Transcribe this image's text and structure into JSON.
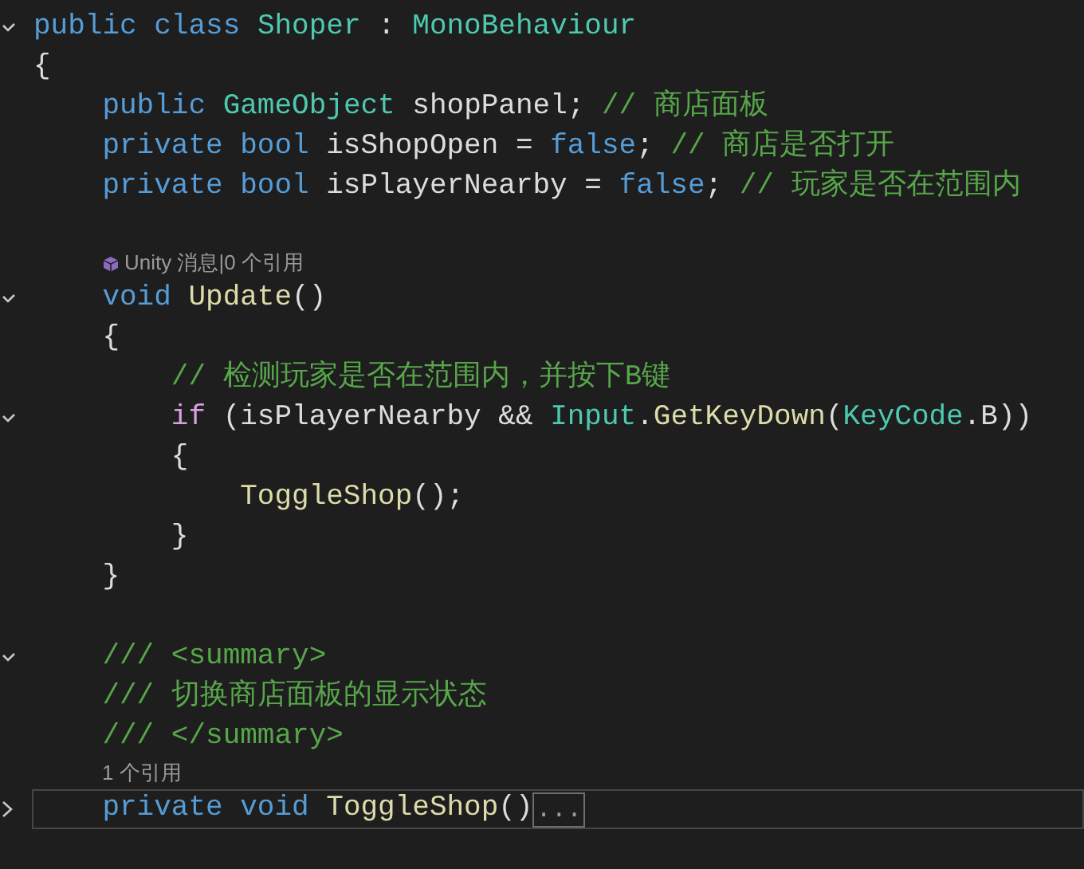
{
  "lines": [
    {
      "kind": "code",
      "expanded": true,
      "current": false,
      "tokens": [
        {
          "kind": "kw",
          "text": "public class "
        },
        {
          "kind": "type",
          "text": "Shoper"
        },
        {
          "kind": "plain",
          "text": " : "
        },
        {
          "kind": "type",
          "text": "MonoBehaviour"
        }
      ]
    },
    {
      "kind": "code",
      "current": false,
      "tokens": [
        {
          "kind": "plain",
          "text": "{"
        }
      ]
    },
    {
      "kind": "code",
      "current": false,
      "tokens": [
        {
          "kind": "kw",
          "text": "    public "
        },
        {
          "kind": "type",
          "text": "GameObject"
        },
        {
          "kind": "plain",
          "text": " shopPanel; "
        },
        {
          "kind": "comment",
          "text": "// 商店面板"
        }
      ]
    },
    {
      "kind": "code",
      "current": false,
      "tokens": [
        {
          "kind": "kw",
          "text": "    private bool"
        },
        {
          "kind": "plain",
          "text": " isShopOpen = "
        },
        {
          "kind": "kw",
          "text": "false"
        },
        {
          "kind": "plain",
          "text": "; "
        },
        {
          "kind": "comment",
          "text": "// 商店是否打开"
        }
      ]
    },
    {
      "kind": "code",
      "current": false,
      "tokens": [
        {
          "kind": "kw",
          "text": "    private bool"
        },
        {
          "kind": "plain",
          "text": " isPlayerNearby = "
        },
        {
          "kind": "kw",
          "text": "false"
        },
        {
          "kind": "plain",
          "text": "; "
        },
        {
          "kind": "comment",
          "text": "// 玩家是否在范围内"
        }
      ]
    },
    {
      "kind": "code",
      "current": false
    },
    {
      "kind": "lens",
      "unity": true,
      "text": "Unity 消息|0 个引用"
    },
    {
      "kind": "code",
      "expanded": true,
      "current": false,
      "tokens": [
        {
          "kind": "kw",
          "text": "    void "
        },
        {
          "kind": "method",
          "text": "Update"
        },
        {
          "kind": "plain",
          "text": "()"
        }
      ]
    },
    {
      "kind": "code",
      "current": false,
      "tokens": [
        {
          "kind": "plain",
          "text": "    {"
        }
      ]
    },
    {
      "kind": "code",
      "current": false,
      "tokens": [
        {
          "kind": "comment",
          "text": "        // 检测玩家是否在范围内，并按下B键"
        }
      ]
    },
    {
      "kind": "code",
      "expanded": true,
      "current": false,
      "tokens": [
        {
          "kind": "control",
          "text": "        if"
        },
        {
          "kind": "plain",
          "text": " (isPlayerNearby && "
        },
        {
          "kind": "type",
          "text": "Input"
        },
        {
          "kind": "plain",
          "text": "."
        },
        {
          "kind": "method",
          "text": "GetKeyDown"
        },
        {
          "kind": "plain",
          "text": "("
        },
        {
          "kind": "type",
          "text": "KeyCode"
        },
        {
          "kind": "plain",
          "text": ".B))"
        }
      ]
    },
    {
      "kind": "code",
      "current": false,
      "tokens": [
        {
          "kind": "plain",
          "text": "        {"
        }
      ]
    },
    {
      "kind": "code",
      "current": false,
      "tokens": [
        {
          "kind": "method",
          "text": "            ToggleShop"
        },
        {
          "kind": "plain",
          "text": "();"
        }
      ]
    },
    {
      "kind": "code",
      "current": false,
      "tokens": [
        {
          "kind": "plain",
          "text": "        }"
        }
      ]
    },
    {
      "kind": "code",
      "current": false,
      "tokens": [
        {
          "kind": "plain",
          "text": "    }"
        }
      ]
    },
    {
      "kind": "code",
      "current": false
    },
    {
      "kind": "code",
      "expanded": true,
      "current": false,
      "tokens": [
        {
          "kind": "doc",
          "text": "    /// <summary>"
        }
      ]
    },
    {
      "kind": "code",
      "current": false,
      "tokens": [
        {
          "kind": "doc",
          "text": "    /// 切换商店面板的显示状态"
        }
      ]
    },
    {
      "kind": "code",
      "current": false,
      "tokens": [
        {
          "kind": "doc",
          "text": "    /// </summary>"
        }
      ]
    },
    {
      "kind": "lens",
      "unity": false,
      "text": "1 个引用"
    },
    {
      "kind": "code",
      "expanded": false,
      "current": true,
      "collapsed_text": "...",
      "tokens": [
        {
          "kind": "kw",
          "text": "    private void "
        },
        {
          "kind": "method",
          "text": "ToggleShop"
        },
        {
          "kind": "plain",
          "text": "()"
        }
      ]
    }
  ]
}
